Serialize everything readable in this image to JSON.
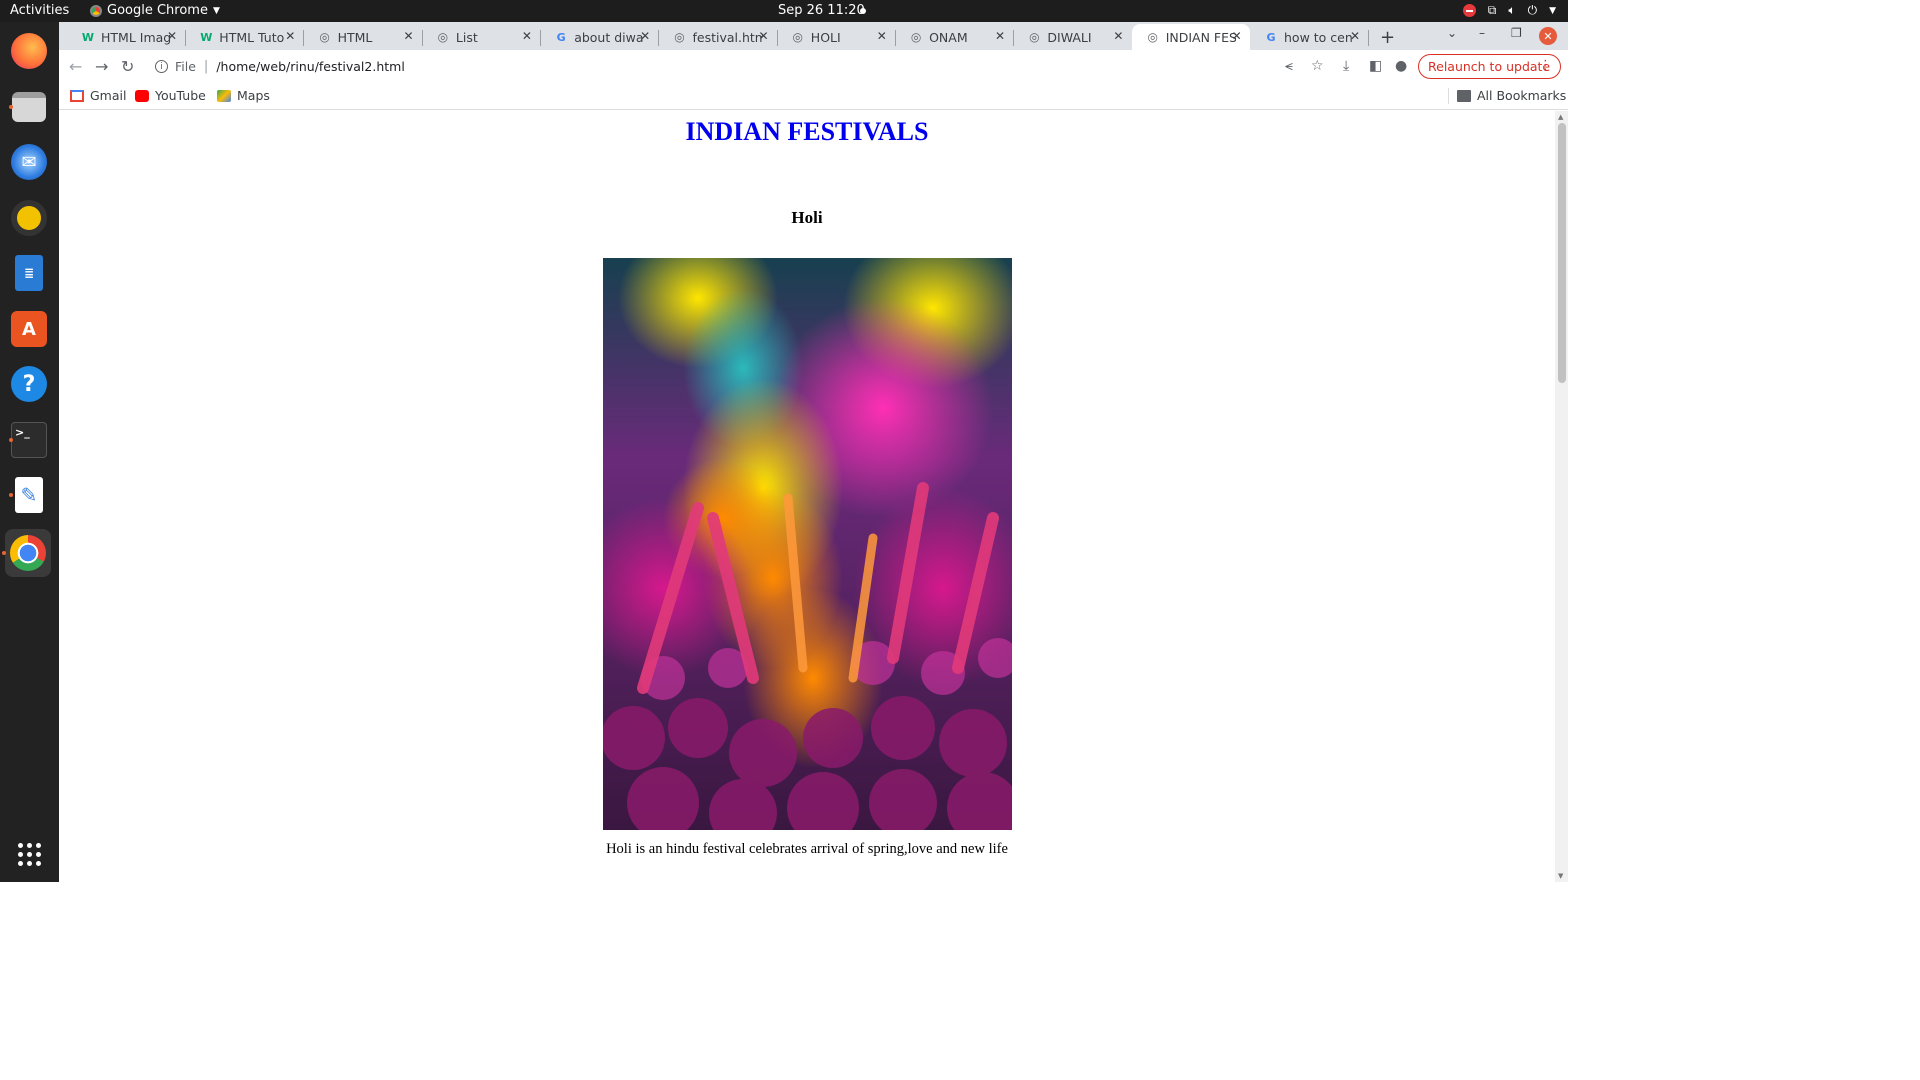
{
  "topbar": {
    "activities": "Activities",
    "app_name": "Google Chrome",
    "clock": "Sep 26  11:20"
  },
  "dock": {
    "items": [
      {
        "name": "firefox",
        "color": "#ff7139"
      },
      {
        "name": "files",
        "color": "#cfcfcf"
      },
      {
        "name": "thunderbird",
        "color": "#2f7de1"
      },
      {
        "name": "rhythmbox",
        "color": "#f2c200"
      },
      {
        "name": "writer",
        "color": "#2a7bd3"
      },
      {
        "name": "software",
        "color": "#e95420"
      },
      {
        "name": "help",
        "color": "#1e88e5"
      },
      {
        "name": "terminal",
        "color": "#333333"
      },
      {
        "name": "text-editor",
        "color": "#3d85e0"
      },
      {
        "name": "chrome",
        "color": "#4285f4"
      }
    ]
  },
  "tabs": [
    {
      "title": "HTML Imag",
      "favicon": "w3-icon"
    },
    {
      "title": "HTML Tuto",
      "favicon": "w3-icon"
    },
    {
      "title": "HTML",
      "favicon": "globe-icon"
    },
    {
      "title": "List",
      "favicon": "globe-icon"
    },
    {
      "title": "about diwa",
      "favicon": "google-icon"
    },
    {
      "title": "festival.htm",
      "favicon": "globe-icon"
    },
    {
      "title": "HOLI",
      "favicon": "globe-icon"
    },
    {
      "title": "ONAM",
      "favicon": "globe-icon"
    },
    {
      "title": "DIWALI",
      "favicon": "globe-icon"
    },
    {
      "title": "INDIAN FES",
      "favicon": "globe-icon",
      "active": true
    },
    {
      "title": "how to cen",
      "favicon": "google-icon"
    }
  ],
  "toolbar": {
    "scheme": "File",
    "url": "/home/web/rinu/festival2.html",
    "relaunch": "Relaunch to update"
  },
  "bookmarks": {
    "gmail": "Gmail",
    "youtube": "YouTube",
    "maps": "Maps",
    "all": "All Bookmarks"
  },
  "page": {
    "heading": "INDIAN FESTIVALS",
    "subheading": "Holi",
    "caption": "Holi is an hindu festival celebrates arrival of spring,love and new life",
    "heading_color": "#0000ee"
  }
}
